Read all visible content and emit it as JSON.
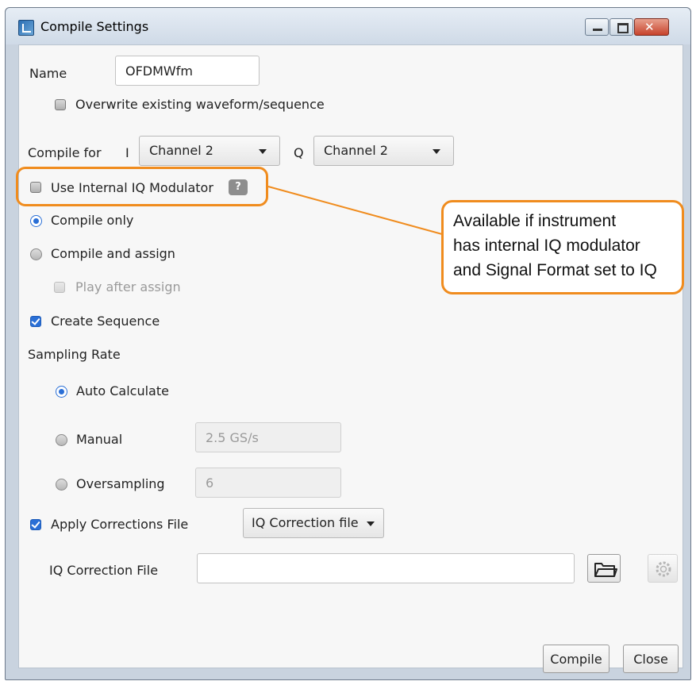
{
  "window": {
    "title": "Compile Settings"
  },
  "name": {
    "label": "Name",
    "value": "OFDMWfm"
  },
  "overwrite": {
    "label": "Overwrite existing waveform/sequence",
    "checked": false
  },
  "compile_for": {
    "label": "Compile for",
    "i_label": "I",
    "i_value": "Channel 2",
    "q_label": "Q",
    "q_value": "Channel 2"
  },
  "iq_modulator": {
    "label": "Use Internal IQ Modulator",
    "help": "?",
    "checked": false
  },
  "callout": {
    "line1": "Available if instrument",
    "line2": "has internal IQ modulator",
    "line3": "and Signal Format set to IQ",
    "color": "#f08c1e"
  },
  "compile_mode": {
    "compile_only": "Compile only",
    "compile_assign": "Compile and assign",
    "play_after": "Play after assign",
    "selected": "compile_only"
  },
  "create_sequence": {
    "label": "Create Sequence",
    "checked": true
  },
  "sampling": {
    "heading": "Sampling Rate",
    "auto": "Auto Calculate",
    "manual": "Manual",
    "manual_value": "2.5 GS/s",
    "oversampling": "Oversampling",
    "oversampling_value": "6",
    "selected": "auto"
  },
  "corrections": {
    "label": "Apply Corrections File",
    "checked": true,
    "type_value": "IQ Correction file",
    "file_label": "IQ Correction File",
    "file_value": ""
  },
  "icons": {
    "folder": "folder-icon",
    "settings": "gear-icon"
  },
  "buttons": {
    "compile": "Compile",
    "close": "Close"
  },
  "colors": {
    "accent": "#2a6fd6",
    "highlight": "#f08c1e"
  }
}
